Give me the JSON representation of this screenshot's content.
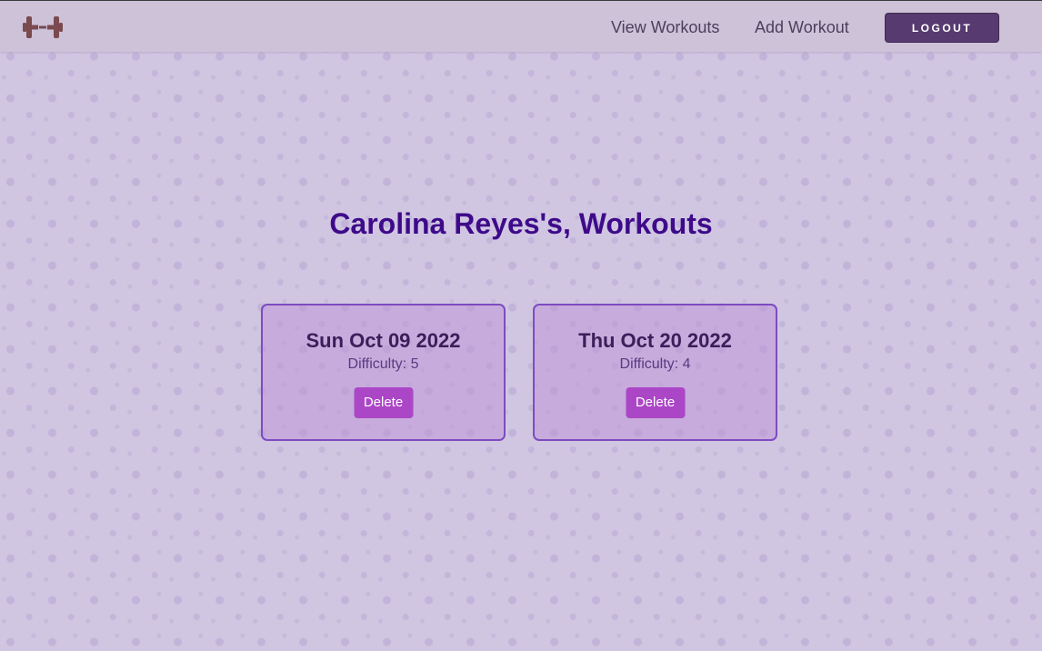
{
  "nav": {
    "logo_icon": "dumbbell-icon",
    "links": [
      {
        "label": "View Workouts"
      },
      {
        "label": "Add Workout"
      }
    ],
    "logout_label": "LOGOUT"
  },
  "page": {
    "title": "Carolina Reyes's, Workouts"
  },
  "workouts": [
    {
      "date": "Sun Oct 09 2022",
      "difficulty": "Difficulty: 5",
      "delete_label": "Delete"
    },
    {
      "date": "Thu Oct 20 2022",
      "difficulty": "Difficulty: 4",
      "delete_label": "Delete"
    }
  ],
  "colors": {
    "accent": "#ab46c6",
    "title": "#3e0a8a",
    "logout_bg": "#573a6f",
    "logo": "#7a4a4f"
  }
}
